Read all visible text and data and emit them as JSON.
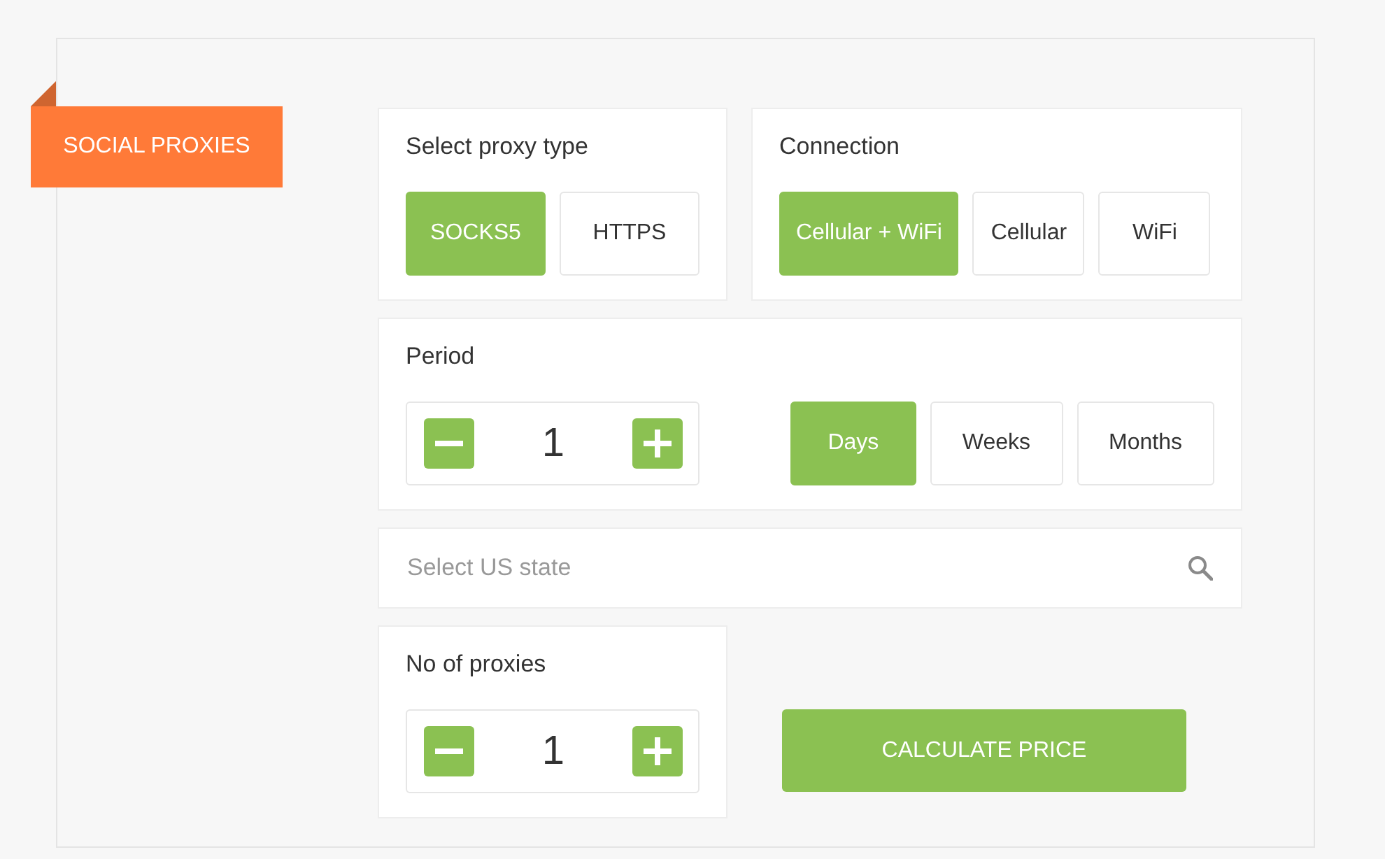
{
  "badge": {
    "label": "SOCIAL PROXIES"
  },
  "proxy_type": {
    "title": "Select proxy type",
    "options": [
      {
        "label": "SOCKS5",
        "selected": true
      },
      {
        "label": "HTTPS",
        "selected": false
      }
    ]
  },
  "connection": {
    "title": "Connection",
    "options": [
      {
        "label": "Cellular + WiFi",
        "selected": true
      },
      {
        "label": "Cellular",
        "selected": false
      },
      {
        "label": "WiFi",
        "selected": false
      }
    ]
  },
  "period": {
    "title": "Period",
    "value": "1",
    "units": [
      {
        "label": "Days",
        "selected": true
      },
      {
        "label": "Weeks",
        "selected": false
      },
      {
        "label": "Months",
        "selected": false
      }
    ]
  },
  "state_search": {
    "placeholder": "Select US state"
  },
  "proxy_count": {
    "title": "No of proxies",
    "value": "1"
  },
  "calculate_button": {
    "label": "CALCULATE PRICE"
  }
}
